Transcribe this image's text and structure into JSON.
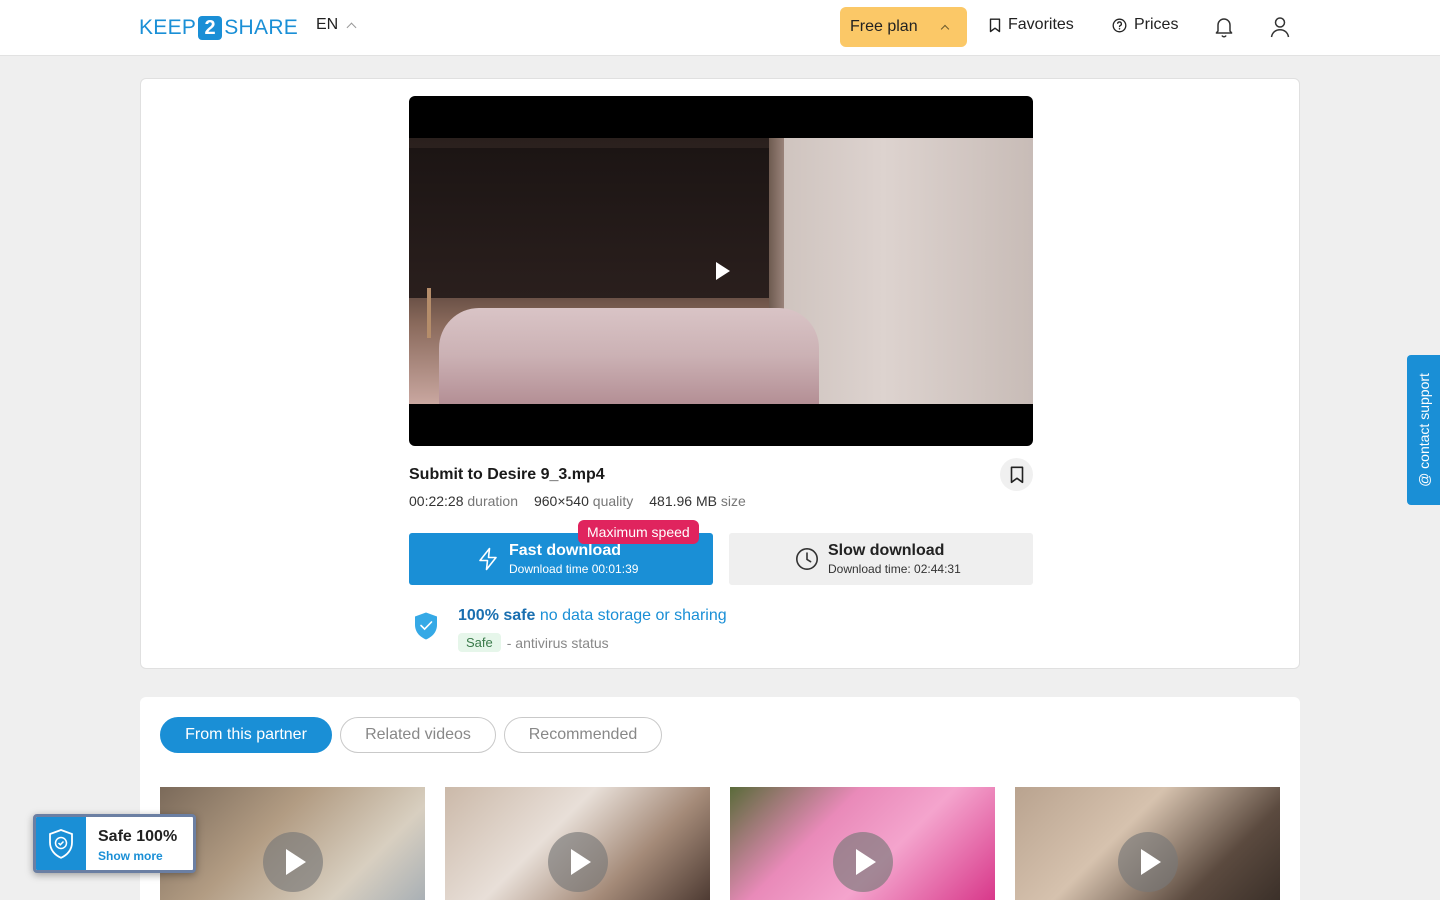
{
  "header": {
    "logo_left": "KEEP",
    "logo_mid": "2",
    "logo_right": "SHARE",
    "language": "EN",
    "plan_label": "Free plan",
    "favorites_label": "Favorites",
    "prices_label": "Prices"
  },
  "file": {
    "title": "Submit to Desire 9_3.mp4",
    "duration_value": "00:22:28",
    "duration_label": "duration",
    "quality_value": "960×540",
    "quality_label": "quality",
    "size_value": "481.96 MB",
    "size_label": "size"
  },
  "download": {
    "fast_label": "Fast download",
    "fast_time": "Download time 00:01:39",
    "max_speed_badge": "Maximum speed",
    "slow_label": "Slow download",
    "slow_time": "Download time: 02:44:31"
  },
  "safety": {
    "strong": "100% safe",
    "link": "no data storage or sharing",
    "badge": "Safe",
    "antivirus_text": "- antivirus status"
  },
  "support_label": "@ contact support",
  "tabs": [
    {
      "label": "From this partner",
      "active": true
    },
    {
      "label": "Related videos",
      "active": false
    },
    {
      "label": "Recommended",
      "active": false
    }
  ],
  "safe_float": {
    "title": "Safe 100%",
    "link": "Show more"
  },
  "colors": {
    "accent": "#1a8fd6",
    "plan": "#fbc867",
    "badge": "#e0245e"
  }
}
